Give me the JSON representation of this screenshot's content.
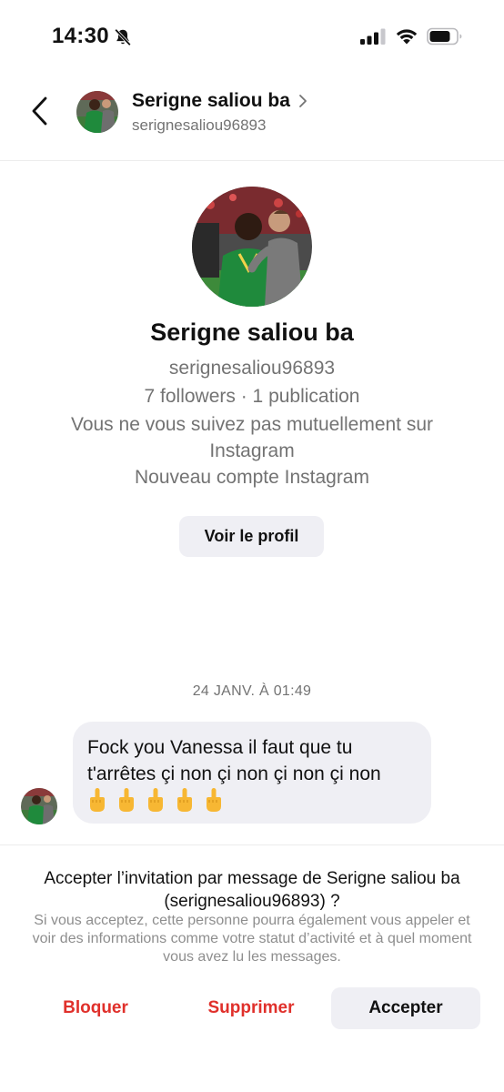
{
  "status_bar": {
    "time": "14:30",
    "icons": [
      "bell-slash-icon",
      "cellular-signal-icon",
      "wifi-icon",
      "battery-icon"
    ]
  },
  "header": {
    "name": "Serigne saliou ba",
    "username": "serignesaliou96893",
    "icons": [
      "chevron-left-icon",
      "chevron-right-icon"
    ]
  },
  "profile": {
    "name": "Serigne saliou ba",
    "username": "serignesaliou96893",
    "stats": "7 followers · 1 publication",
    "mutual": "Vous ne vous suivez pas mutuellement sur Instagram",
    "new_account": "Nouveau compte Instagram",
    "view_profile_label": "Voir le profil"
  },
  "messages": {
    "timestamp": "24 JANV. À 01:49",
    "items": [
      {
        "text": "Fock you Vanessa il faut que tu t'arrêtes çi non çi non çi non çi non",
        "emoji_icons": [
          "middle-finger-icon",
          "middle-finger-icon",
          "middle-finger-icon",
          "middle-finger-icon",
          "middle-finger-icon"
        ]
      }
    ]
  },
  "request": {
    "title": "Accepter l’invitation par message de Serigne saliou ba (serignesaliou96893) ?",
    "description": "Si vous acceptez, cette personne pourra également vous appeler et voir des informations comme votre statut d’activité et à quel moment vous avez lu les messages.",
    "block_label": "Bloquer",
    "delete_label": "Supprimer",
    "accept_label": "Accepter"
  },
  "colors": {
    "destructive": "#e0302b",
    "secondary_text": "#737373",
    "button_bg": "#efeff4",
    "avatar_jersey": "#1f8a3c"
  }
}
